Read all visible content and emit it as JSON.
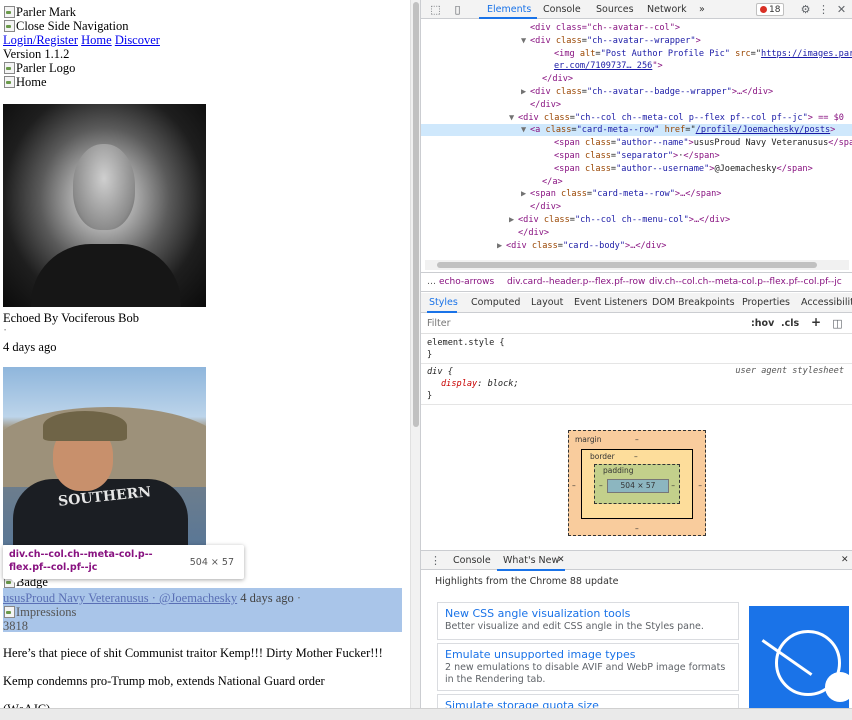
{
  "page": {
    "parler_mark_alt": "Parler Mark",
    "close_nav_alt": "Close Side Navigation",
    "login_register": "Login/Register",
    "home_link": "Home",
    "discover_link": "Discover",
    "version": "Version 1.1.2",
    "parler_logo_alt": "Parler Logo",
    "home_alt": "Home",
    "echoed_by": "Echoed By Vociferous Bob",
    "dot": "·",
    "time_ago_1": "4 days ago",
    "badge_alt": "Badge",
    "author_name": "ususProud Navy Veteranusus",
    "separator": "·",
    "username": "@Joemachesky",
    "time_ago_2": "4 days ago",
    "trailing_dot": "·",
    "impressions_alt": "Impressions",
    "impressions_count": "3818",
    "post_text": "Here’s that piece of shit Communist traitor Kemp!!! Dirty Mother Fucker!!!",
    "headline": "Kemp condemns pro-Trump mob, extends National Guard order",
    "cut_line": "(WsAJC)",
    "shirt_text": "SOUTHERN"
  },
  "tooltip": {
    "selector": "div.ch--col.ch--meta-col.p--flex.pf--col.pf--jc",
    "size": "504 × 57"
  },
  "devtools": {
    "tabs": [
      "Elements",
      "Console",
      "Sources",
      "Network"
    ],
    "more": "»",
    "error_count": "18",
    "elements_lines": [
      {
        "indent": 8,
        "arrow": "",
        "html": "<div class=\"ch--avatar--col\">"
      },
      {
        "indent": 8,
        "arrow": "▼",
        "tag_open": "<div ",
        "attr": "class",
        "val": "\"ch--avatar--wrapper\"",
        "tag_close": ">"
      },
      {
        "indent": 10,
        "arrow": "",
        "tag_open": "<img ",
        "attr": "alt",
        "val": "\"Post Author Profile Pic\"",
        "attr2": "src",
        "link": "https://images.parl"
      },
      {
        "indent": 10,
        "arrow": "",
        "link_cont": "er.com/7109737… 256",
        "tail": "\">"
      },
      {
        "indent": 9,
        "arrow": "",
        "tag_open": "</div>"
      },
      {
        "indent": 8,
        "arrow": "▶",
        "tag_open": "<div ",
        "attr": "class",
        "val": "\"ch--avatar--badge--wrapper\"",
        "tag_close": ">…</div>"
      },
      {
        "indent": 8,
        "arrow": "",
        "tag_open": "</div>"
      },
      {
        "indent": 7,
        "arrow": "▼",
        "tag_open": "<div ",
        "attr": "class",
        "val": "\"ch--col ch--meta-col p--flex pf--col pf--jc\"",
        "tag_close": "> == $0"
      },
      {
        "indent": 8,
        "arrow": "▼",
        "tag_open": "<a ",
        "attr": "class",
        "val": "\"card-meta--row\"",
        "attr2": "href",
        "link": "/profile/Joemachesky/posts",
        "tail": ">"
      },
      {
        "indent": 10,
        "arrow": "",
        "tag_open": "<span ",
        "attr": "class",
        "val": "\"author--name\"",
        "tag_close": ">",
        "text": "ususProud Navy Veteranusus",
        "end": "</span>"
      },
      {
        "indent": 10,
        "arrow": "",
        "tag_open": "<span ",
        "attr": "class",
        "val": "\"separator\"",
        "tag_close": ">",
        "text": "·",
        "end": "</span>"
      },
      {
        "indent": 10,
        "arrow": "",
        "tag_open": "<span ",
        "attr": "class",
        "val": "\"author--username\"",
        "tag_close": ">",
        "text": "@Joemachesky",
        "end": "</span>"
      },
      {
        "indent": 9,
        "arrow": "",
        "tag_open": "</a>"
      },
      {
        "indent": 8,
        "arrow": "▶",
        "tag_open": "<span ",
        "attr": "class",
        "val": "\"card-meta--row\"",
        "tag_close": ">…</span>"
      },
      {
        "indent": 8,
        "arrow": "",
        "tag_open": "</div>"
      },
      {
        "indent": 7,
        "arrow": "▶",
        "tag_open": "<div ",
        "attr": "class",
        "val": "\"ch--col ch--menu-col\"",
        "tag_close": ">…</div>"
      },
      {
        "indent": 7,
        "arrow": "",
        "tag_open": "</div>"
      },
      {
        "indent": 6,
        "arrow": "▶",
        "tag_open": "<div ",
        "attr": "class",
        "val": "\"card--body\"",
        "tag_close": ">…</div>"
      }
    ],
    "breadcrumbs": [
      "…",
      "echo-arrows",
      "div.card--header.p--flex.pf--row",
      "div.ch--col.ch--meta-col.p--flex.pf--col.pf--jc"
    ],
    "styles_tabs": [
      "Styles",
      "Computed",
      "Layout",
      "Event Listeners",
      "DOM Breakpoints",
      "Properties",
      "Accessibility"
    ],
    "filter_placeholder": "Filter",
    "hov": ":hov",
    "cls": ".cls",
    "plus": "+",
    "element_style": "element.style {",
    "close_brace": "}",
    "rule_selector": "div {",
    "ua_label": "user agent stylesheet",
    "rule_prop": "display",
    "rule_val": "block;",
    "box_model": {
      "margin": "margin",
      "border": "border",
      "padding": "padding",
      "content": "504 × 57",
      "dash": "–"
    },
    "drawer_tabs": [
      "Console",
      "What's New"
    ],
    "highlights": "Highlights from the Chrome 88 update",
    "cards": [
      {
        "title": "New CSS angle visualization tools",
        "desc": "Better visualize and edit CSS angle in the Styles pane."
      },
      {
        "title": "Emulate unsupported image types",
        "desc": "2 new emulations to disable AVIF and WebP image formats in the Rendering tab."
      },
      {
        "title": "Simulate storage quota size",
        "desc": ""
      }
    ]
  },
  "colors": {
    "accent": "#1a73e8",
    "tag": "#881280",
    "attr": "#994500",
    "val": "#1a1aa6",
    "highlight": "#6f9edb"
  }
}
